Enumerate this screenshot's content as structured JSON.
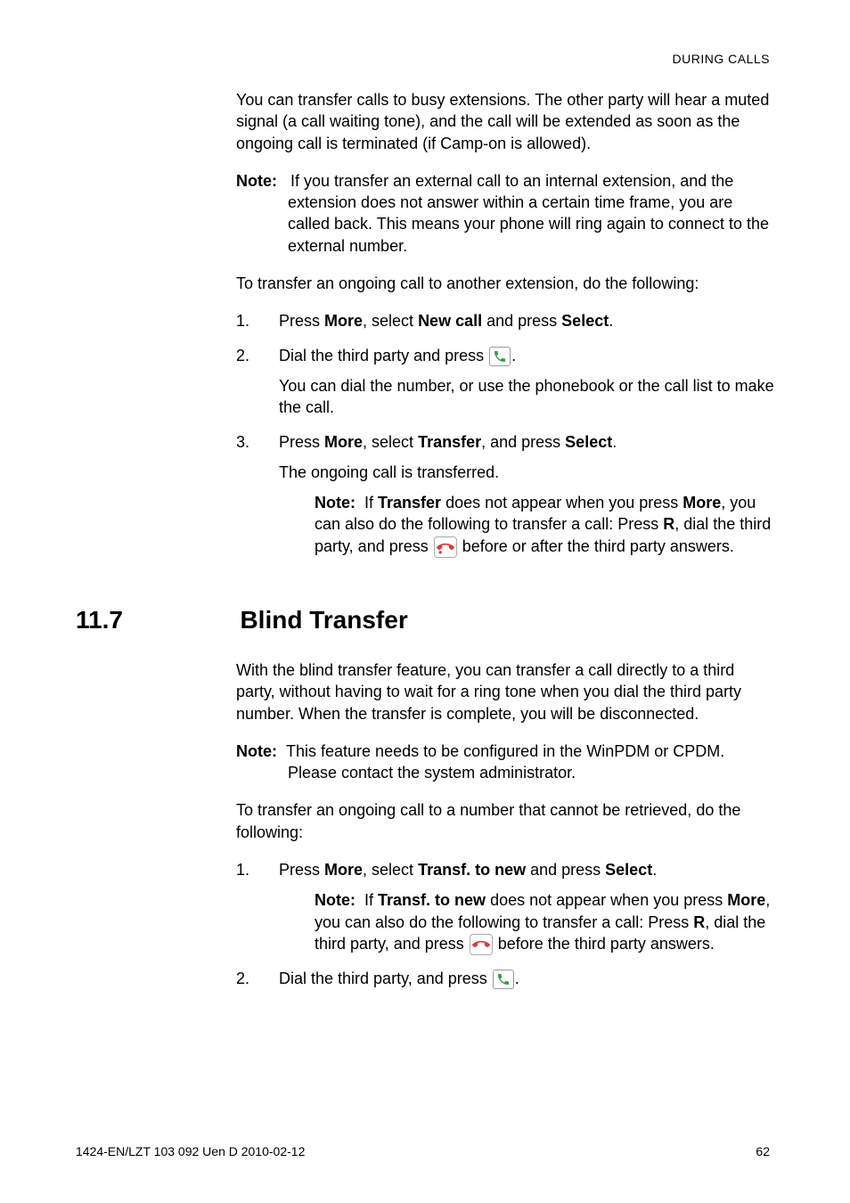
{
  "header": {
    "right": "DURING CALLS"
  },
  "intro": {
    "p1": "You can transfer calls to busy extensions. The other party will hear a muted signal (a call waiting tone), and the call will be extended as soon as the ongoing call is terminated (if Camp-on is allowed).",
    "note_label": "Note:",
    "note_text": "If you transfer an external call to an internal extension, and the extension does not answer within a certain time frame, you are called back. This means your phone will ring again to connect to the external number.",
    "p2": "To transfer an ongoing call to another extension, do the following:"
  },
  "steps1": {
    "s1_num": "1.",
    "s1_a": "Press ",
    "s1_b": "More",
    "s1_c": ", select ",
    "s1_d": "New call",
    "s1_e": " and press ",
    "s1_f": "Select",
    "s1_g": ".",
    "s2_num": "2.",
    "s2_a": "Dial the third party and press ",
    "s2_b": ".",
    "s2_body": "You can dial the number, or use the phonebook or the call list to make the call.",
    "s3_num": "3.",
    "s3_a": "Press ",
    "s3_b": "More",
    "s3_c": ", select ",
    "s3_d": "Transfer",
    "s3_e": ", and press ",
    "s3_f": "Select",
    "s3_g": ".",
    "s3_body": "The ongoing call is transferred.",
    "s3_note_label": "Note:",
    "s3_note_a": "If ",
    "s3_note_b": "Transfer",
    "s3_note_c": " does not appear when you press ",
    "s3_note_d": "More",
    "s3_note_e": ", you can also do the following to transfer a call: Press ",
    "s3_note_f": "R",
    "s3_note_g": ", dial the third party, and press ",
    "s3_note_h": " before or after the third party answers."
  },
  "section": {
    "num": "11.7",
    "title": "Blind Transfer"
  },
  "blind": {
    "p1": "With the blind transfer feature, you can transfer a call directly to a third party, without having to wait for a ring tone when you dial the third party number. When the transfer is complete, you will be disconnected.",
    "note_label": "Note:",
    "note_text": "This feature needs to be configured in the WinPDM or CPDM. Please contact the system administrator.",
    "p2": "To transfer an ongoing call to a number that cannot be retrieved, do the following:"
  },
  "steps2": {
    "s1_num": "1.",
    "s1_a": "Press ",
    "s1_b": "More",
    "s1_c": ", select ",
    "s1_d": "Transf. to new",
    "s1_e": " and press ",
    "s1_f": "Select",
    "s1_g": ".",
    "s1_note_label": "Note:",
    "s1_note_a": "If ",
    "s1_note_b": "Transf. to new",
    "s1_note_c": " does not appear when you press ",
    "s1_note_d": "More",
    "s1_note_e": ", you can also do the following to transfer a call: Press ",
    "s1_note_f": "R",
    "s1_note_g": ", dial the third party, and press ",
    "s1_note_h": " before the third party answers.",
    "s2_num": "2.",
    "s2_a": "Dial the third party, and press ",
    "s2_b": "."
  },
  "footer": {
    "left": "1424-EN/LZT 103 092 Uen D 2010-02-12",
    "right": "62"
  }
}
